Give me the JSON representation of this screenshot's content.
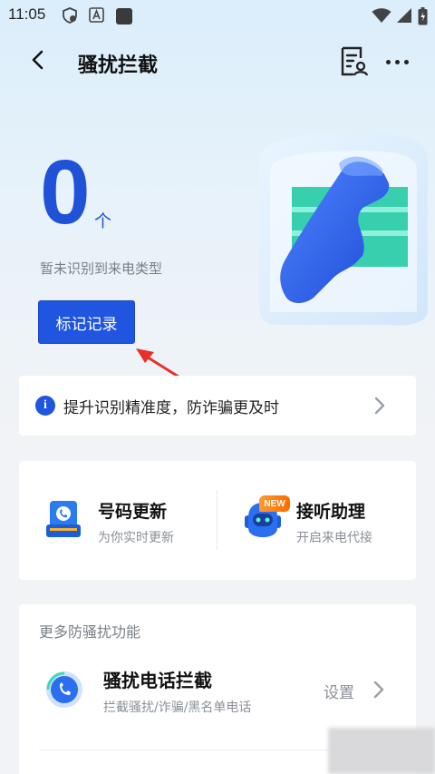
{
  "status_bar": {
    "time": "11:05",
    "left_icons": [
      "shield-icon",
      "font-a-icon",
      "app-square-icon"
    ],
    "right_icons": [
      "wifi-icon",
      "signal-icon",
      "battery-icon"
    ]
  },
  "header": {
    "title": "骚扰拦截",
    "back_icon": "chevron-left-icon",
    "report_icon": "report-list-icon",
    "more_icon": "more-dots-icon"
  },
  "summary": {
    "count": "0",
    "unit": "个",
    "description": "暂未识别到来电类型",
    "mark_button": "标记记录"
  },
  "tip": {
    "icon": "info-icon",
    "text": "提升识别精准度，防诈骗更及时"
  },
  "features": [
    {
      "title": "号码更新",
      "subtitle": "为你实时更新",
      "icon": "number-update-icon"
    },
    {
      "title": "接听助理",
      "subtitle": "开启来电代接",
      "icon": "robot-assistant-icon",
      "badge": "NEW"
    }
  ],
  "more_section": {
    "title": "更多防骚扰功能",
    "items": [
      {
        "title": "骚扰电话拦截",
        "subtitle": "拦截骚扰/诈骗/黑名单电话",
        "action": "设置",
        "icon": "phone-block-icon"
      }
    ]
  },
  "colors": {
    "accent": "#2055e0",
    "annotation_arrow": "#e8302a"
  }
}
